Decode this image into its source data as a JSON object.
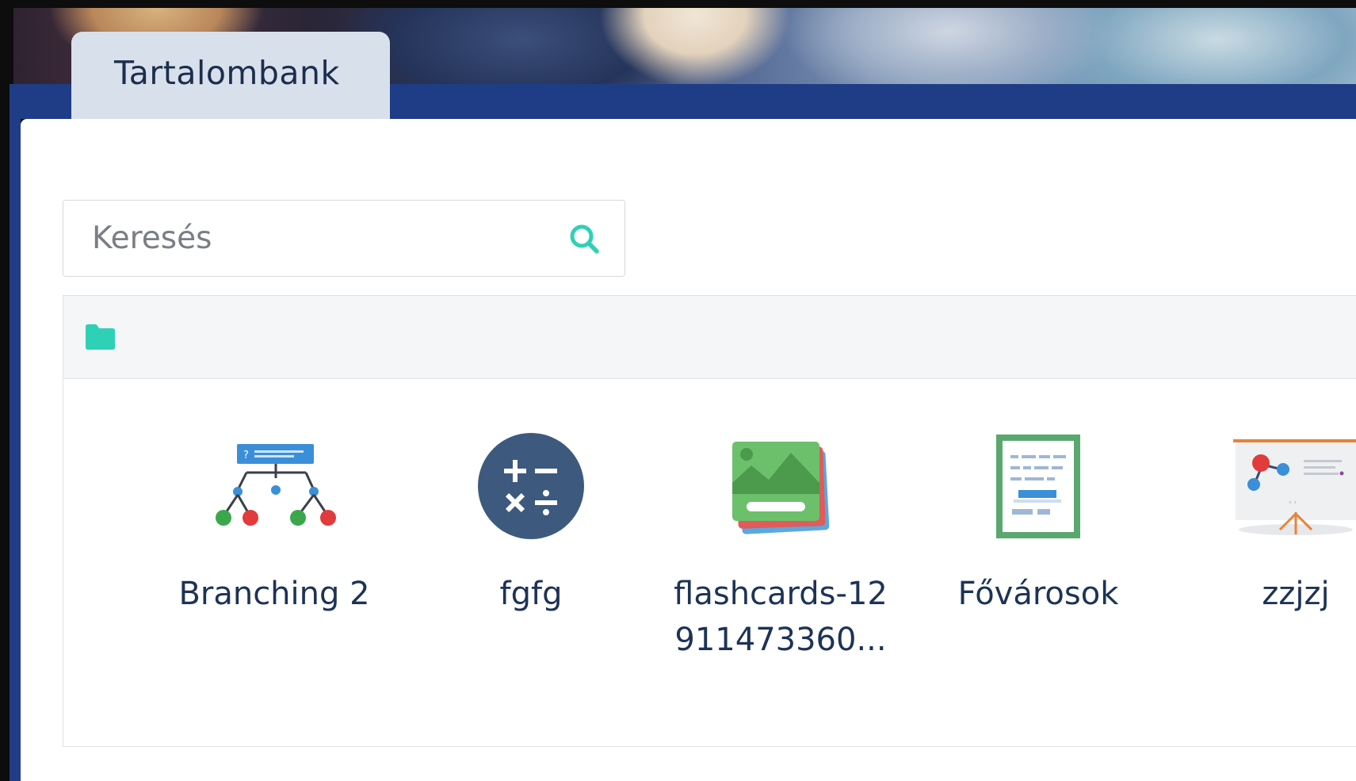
{
  "header": {
    "tab_label": "Tartalombank"
  },
  "search": {
    "placeholder": "Keresés",
    "value": ""
  },
  "breadcrumb": {
    "icon": "folder-icon",
    "color": "#2fd1b6"
  },
  "items": [
    {
      "label": "Branching 2",
      "icon": "branching-icon"
    },
    {
      "label": "fgfg",
      "icon": "calculator-icon"
    },
    {
      "label": "flashcards-12\n911473360...",
      "icon": "flashcards-icon"
    },
    {
      "label": "Fővárosok",
      "icon": "document-icon"
    },
    {
      "label": "zzjzj",
      "icon": "presentation-icon"
    }
  ],
  "colors": {
    "accent": "#2fd1b6",
    "nav_blue": "#1f3d86",
    "tab_bg": "#d8e0eb",
    "text_dark": "#1d3356"
  }
}
